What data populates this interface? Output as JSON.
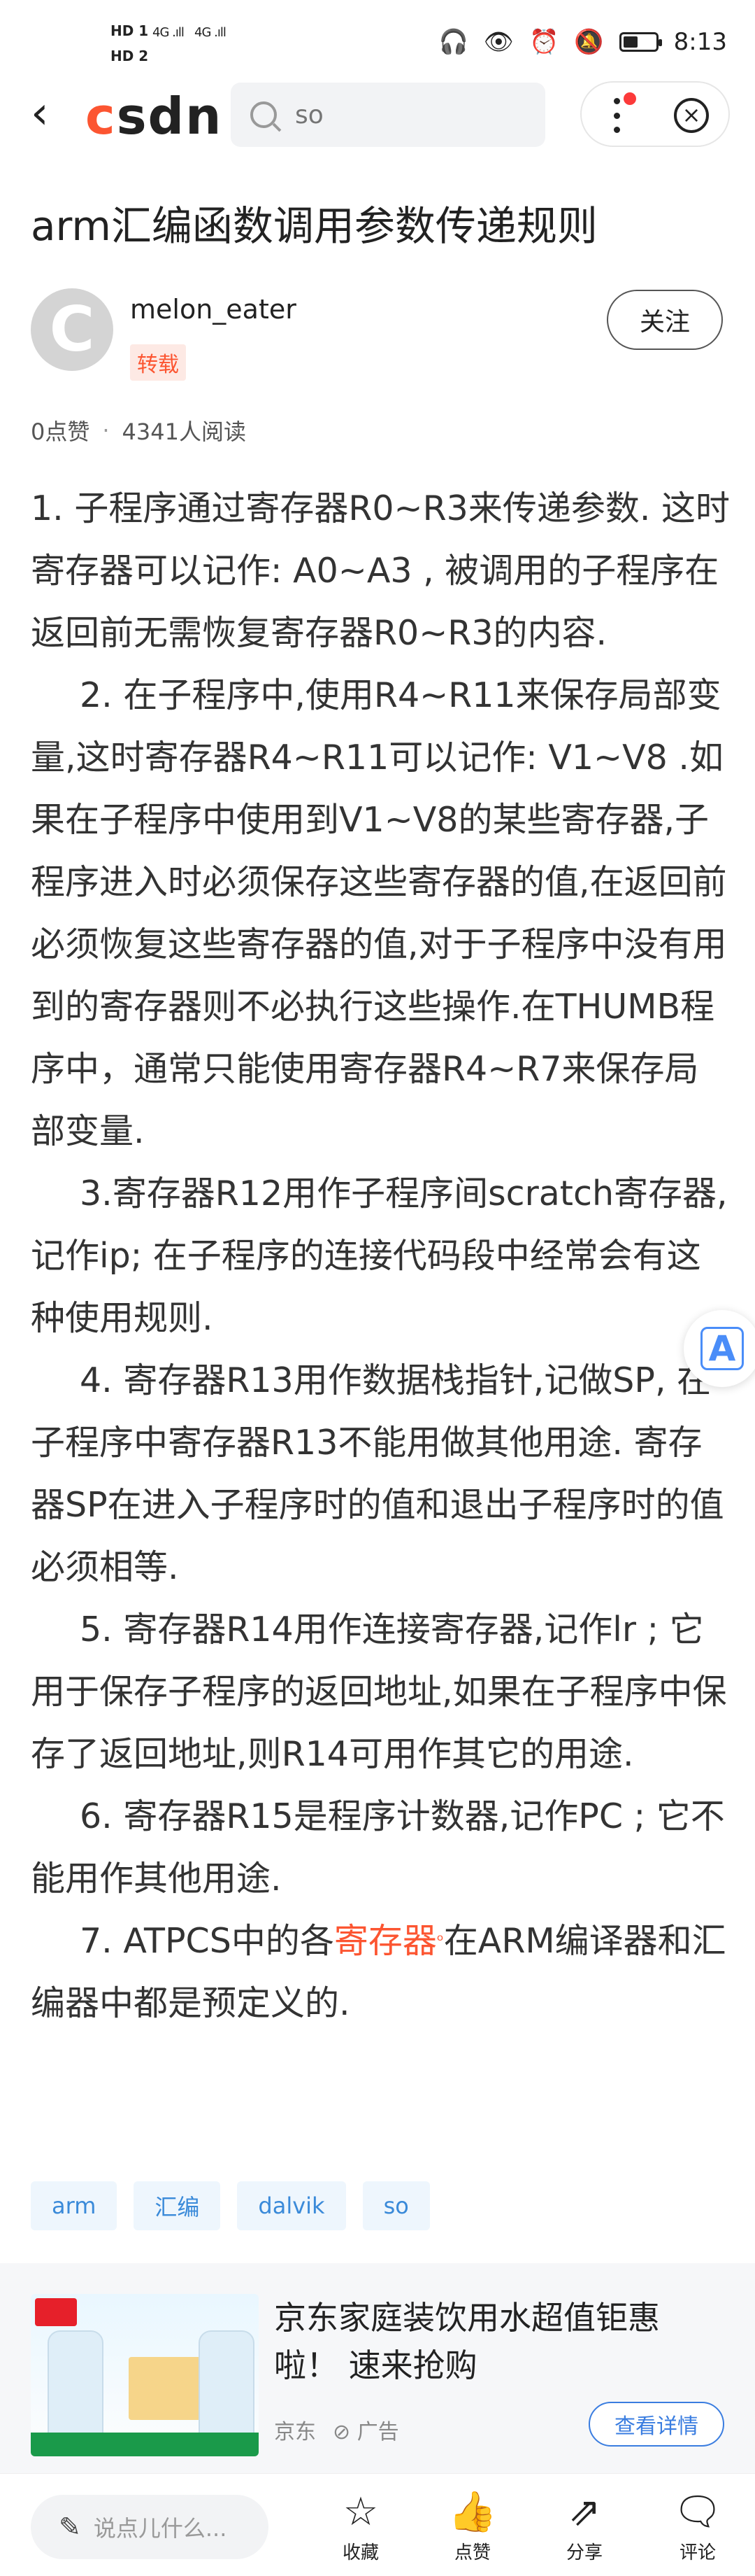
{
  "status_bar": {
    "hd1": "HD 1",
    "hd2": "HD 2",
    "signal1": "4G .ıll",
    "signal2": "4G .ıll",
    "time": "8:13"
  },
  "top_bar": {
    "logo_c": "c",
    "logo_rest": "sdn",
    "search_placeholder": "so"
  },
  "article": {
    "title": "arm汇编函数调用参数传递规则",
    "author": "melon_eater",
    "repost_badge": "转载",
    "follow_label": "关注",
    "likes": "0点赞",
    "separator": "·",
    "reads": "4341人阅读",
    "paragraphs": [
      "1. 子程序通过寄存器R0~R3来传递参数. 这时寄存器可以记作: A0~A3 , 被调用的子程序在返回前无需恢复寄存器R0~R3的内容.",
      "2. 在子程序中,使用R4~R11来保存局部变量,这时寄存器R4~R11可以记作: V1~V8 .如果在子程序中使用到V1~V8的某些寄存器,子程序进入时必须保存这些寄存器的值,在返回前必须恢复这些寄存器的值,对于子程序中没有用到的寄存器则不必执行这些操作.在THUMB程序中，通常只能使用寄存器R4~R7来保存局部变量.",
      "3.寄存器R12用作子程序间scratch寄存器,记作ip; 在子程序的连接代码段中经常会有这种使用规则.",
      "4. 寄存器R13用作数据栈指针,记做SP, 在子程序中寄存器R13不能用做其他用途. 寄存器SP在进入子程序时的值和退出子程序时的值必须相等.",
      "5. 寄存器R14用作连接寄存器,记作lr ; 它用于保存子程序的返回地址,如果在子程序中保存了返回地址,则R14可用作其它的用途.",
      "6. 寄存器R15是程序计数器,记作PC ; 它不能用作其他用途."
    ],
    "p7_before": "7. ATPCS中的各",
    "p7_keyword": "寄存器",
    "p7_after": "在ARM编译器和汇编器中都是预定义的."
  },
  "tags": [
    "arm",
    "汇编",
    "dalvik",
    "so"
  ],
  "ad": {
    "title": "京东家庭装饮用水超值钜惠啦！ 速来抢购",
    "source": "京东",
    "ad_label": "广告",
    "button": "查看详情"
  },
  "bottom_bar": {
    "comment_placeholder": "说点儿什么...",
    "collect": "收藏",
    "like": "点赞",
    "share": "分享",
    "comment": "评论"
  }
}
